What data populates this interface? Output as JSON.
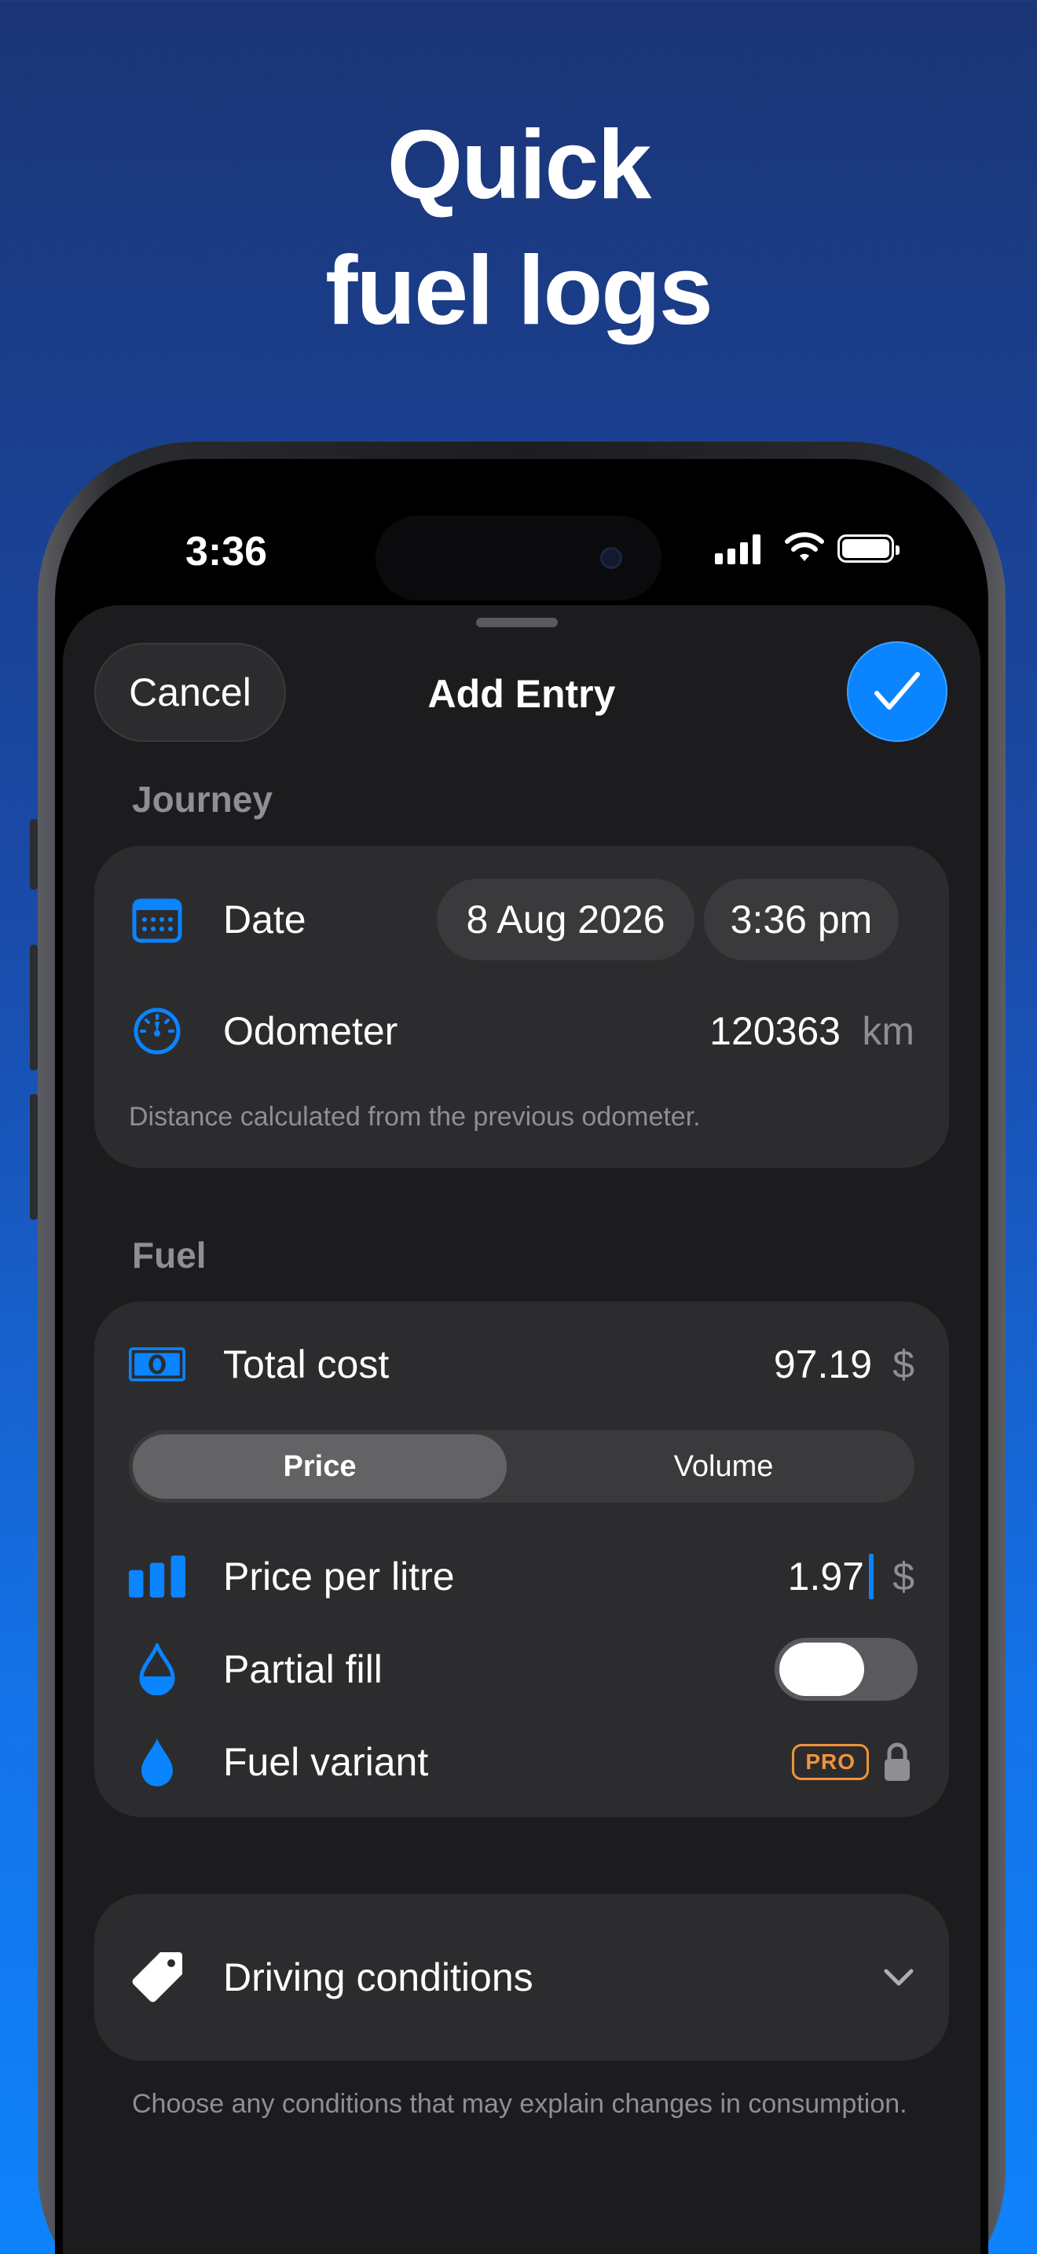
{
  "headline": {
    "line1": "Quick",
    "line2": "fuel logs"
  },
  "status_bar": {
    "time": "3:36"
  },
  "sheet": {
    "cancel_label": "Cancel",
    "title": "Add Entry",
    "confirm_icon": "checkmark-icon"
  },
  "journey": {
    "section_label": "Journey",
    "date_label": "Date",
    "date_value": "8 Aug 2026",
    "time_value": "3:36 pm",
    "odometer_label": "Odometer",
    "odometer_value": "120363",
    "odometer_unit": "km",
    "footnote": "Distance calculated from the previous odometer."
  },
  "fuel": {
    "section_label": "Fuel",
    "total_cost_label": "Total cost",
    "total_cost_value": "97.19",
    "currency": "$",
    "segments": [
      "Price",
      "Volume"
    ],
    "selected_segment": "Price",
    "price_label": "Price per litre",
    "price_value": "1.97",
    "partial_fill_label": "Partial fill",
    "partial_fill_on": true,
    "fuel_variant_label": "Fuel variant",
    "pro_badge": "PRO"
  },
  "conditions": {
    "label": "Driving conditions",
    "footnote": "Choose any conditions that may explain changes in consumption."
  },
  "colors": {
    "accent": "#0a84ff",
    "pro": "#f0943a",
    "card": "#2c2c2e",
    "sheet": "#1c1c1e"
  }
}
